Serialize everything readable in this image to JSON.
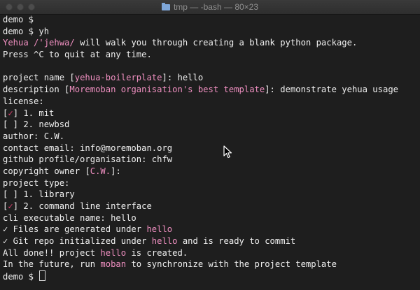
{
  "window": {
    "title": "tmp — -bash — 80×23"
  },
  "terminal": {
    "lines": [
      {
        "name": "prompt-line",
        "parts": [
          {
            "t": "demo $ "
          }
        ]
      },
      {
        "name": "command-line",
        "parts": [
          {
            "t": "demo $ yh"
          }
        ]
      },
      {
        "name": "intro-line",
        "parts": [
          {
            "t": "Yehua /'jehwa/",
            "c": "pink"
          },
          {
            "t": " will walk you through creating a blank python package."
          }
        ]
      },
      {
        "name": "quit-hint-line",
        "parts": [
          {
            "t": "Press ^C to quit at any time."
          }
        ]
      },
      {
        "name": "blank-line",
        "parts": [
          {
            "t": ""
          }
        ]
      },
      {
        "name": "project-name-line",
        "parts": [
          {
            "t": "project name ["
          },
          {
            "t": "yehua-boilerplate",
            "c": "pink"
          },
          {
            "t": "]: hello"
          }
        ]
      },
      {
        "name": "description-line",
        "parts": [
          {
            "t": "description ["
          },
          {
            "t": "Moremoban organisation's best template",
            "c": "pink"
          },
          {
            "t": "]: demonstrate yehua usage"
          }
        ]
      },
      {
        "name": "license-line",
        "parts": [
          {
            "t": "license:"
          }
        ]
      },
      {
        "name": "license-option-mit",
        "parts": [
          {
            "t": "[",
            "c": "bx"
          },
          {
            "t": "✓",
            "c": "check"
          },
          {
            "t": "] 1. mit",
            "c": "bx"
          }
        ]
      },
      {
        "name": "license-option-newbsd",
        "parts": [
          {
            "t": "[ ] 2. newbsd"
          }
        ]
      },
      {
        "name": "author-line",
        "parts": [
          {
            "t": "author: C.W."
          }
        ]
      },
      {
        "name": "contact-email-line",
        "parts": [
          {
            "t": "contact email: info@moremoban.org"
          }
        ]
      },
      {
        "name": "github-line",
        "parts": [
          {
            "t": "github profile/organisation: chfw"
          }
        ]
      },
      {
        "name": "copyright-line",
        "parts": [
          {
            "t": "copyright owner ["
          },
          {
            "t": "C.W.",
            "c": "pink"
          },
          {
            "t": "]:"
          }
        ]
      },
      {
        "name": "project-type-line",
        "parts": [
          {
            "t": "project type:"
          }
        ]
      },
      {
        "name": "project-type-library",
        "parts": [
          {
            "t": "[ ] 1. library"
          }
        ]
      },
      {
        "name": "project-type-cli",
        "parts": [
          {
            "t": "[",
            "c": "bx"
          },
          {
            "t": "✓",
            "c": "check"
          },
          {
            "t": "] 2. command line interface",
            "c": "bx"
          }
        ]
      },
      {
        "name": "cli-name-line",
        "parts": [
          {
            "t": "cli executable name: hello"
          }
        ]
      },
      {
        "name": "files-generated-line",
        "parts": [
          {
            "t": "✓ Files are generated under "
          },
          {
            "t": "hello",
            "c": "pink"
          }
        ]
      },
      {
        "name": "git-repo-line",
        "parts": [
          {
            "t": "✓ Git repo initialized under "
          },
          {
            "t": "hello",
            "c": "pink"
          },
          {
            "t": " and is ready to commit"
          }
        ]
      },
      {
        "name": "all-done-line",
        "parts": [
          {
            "t": "All done!! project "
          },
          {
            "t": "hello",
            "c": "pink"
          },
          {
            "t": " is created."
          }
        ]
      },
      {
        "name": "future-line",
        "parts": [
          {
            "t": "In the future, run "
          },
          {
            "t": "moban",
            "c": "pink"
          },
          {
            "t": " to synchronize with the project template"
          }
        ]
      },
      {
        "name": "final-prompt-line",
        "parts": [
          {
            "t": "demo $ "
          }
        ],
        "cursor": true
      }
    ]
  }
}
